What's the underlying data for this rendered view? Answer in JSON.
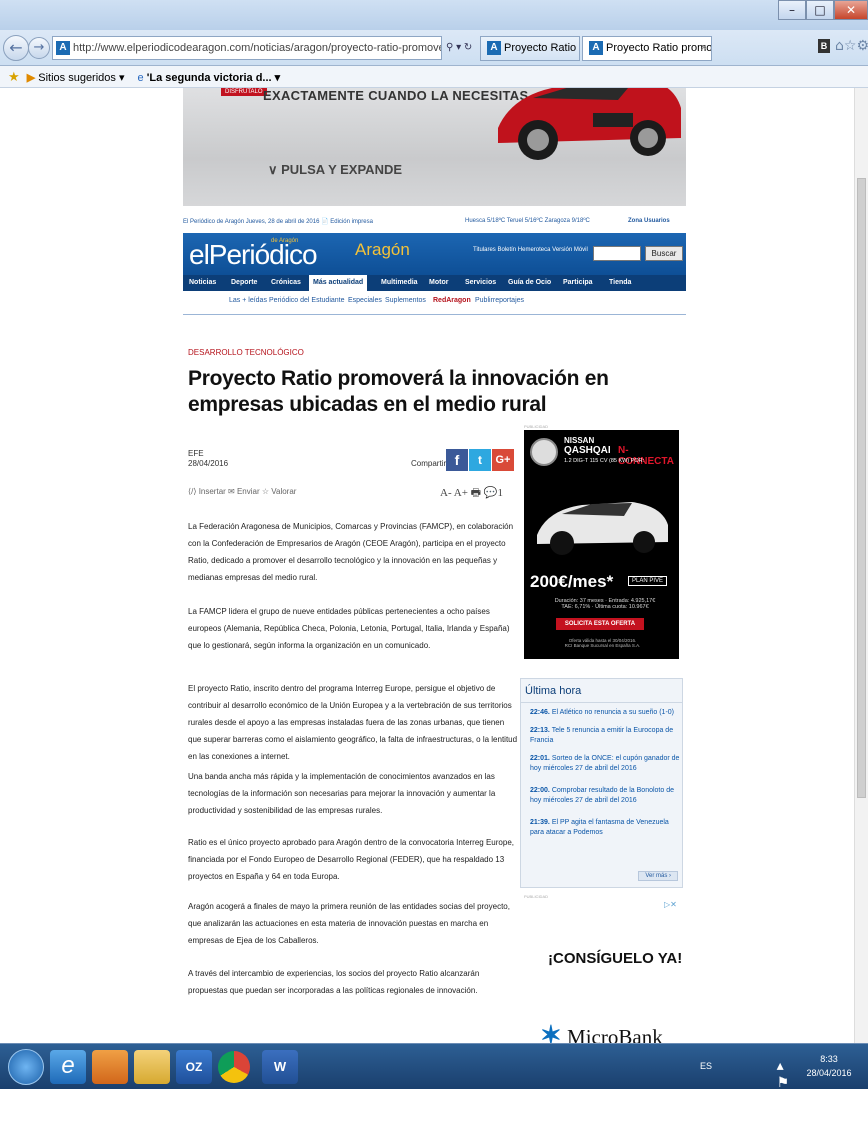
{
  "browser": {
    "address": "http://www.elperiodicodearagon.com/noticias/aragon/proyecto-ratio-promovera-innovaci",
    "address_domain": "elperiodicodearagon.com",
    "tabs": [
      {
        "label": "Proyecto Ratio promoverá la in..."
      },
      {
        "label": "Proyecto Ratio promoverá l..."
      }
    ],
    "tab_close": "×",
    "favorites": {
      "suggested": "Sitios sugeridos ▾",
      "link": "'La segunda victoria d... ▾"
    }
  },
  "ad_top": {
    "tag": "DISFRUTALO",
    "headline": "EXACTAMENTE CUANDO LA NECESITAS.",
    "cta": "∨ PULSA Y EXPANDE"
  },
  "site": {
    "meta": "El Periódico de Aragón  Jueves, 28 de abril de 2016  📄 Edición impresa",
    "weather": "Huesca 5/18ºC  Teruel 5/16ºC  Zaragoza 9/18ºC",
    "zona_usuarios": "Zona Usuarios",
    "logo": "elPeriódico",
    "logo_sub": "de Aragón",
    "region": "Aragón",
    "header_links": "Titulares  Boletín  Hemeroteca  Versión Móvil",
    "search_button": "Buscar",
    "nav": [
      "Noticias",
      "Deporte",
      "Crónicas",
      "Más actualidad",
      "Multimedia",
      "Motor",
      "Servicios",
      "Guía de Ocio",
      "Participa",
      "Tienda"
    ],
    "subnav": [
      "Las + leídas",
      "Periódico del Estudiante",
      "Especiales",
      "Suplementos",
      "RedAragon",
      "Publirreportajes"
    ]
  },
  "article": {
    "category": "DESARROLLO TECNOLÓGICO",
    "title": "Proyecto Ratio promoverá la innovación en empresas ubicadas en el medio rural",
    "author": "EFE",
    "date": "28/04/2016",
    "share_label": "Compartir:",
    "tools": "⟨/⟩ Insertar   ✉ Enviar   ☆ Valorar",
    "font_tools": "A-  A+  🖶  💬1",
    "paragraphs": [
      "La Federación Aragonesa de Municipios, Comarcas y Provincias (FAMCP), en colaboración con la Confederación de Empresarios de Aragón (CEOE Aragón), participa en el proyecto Ratio, dedicado a promover el desarrollo tecnológico y la innovación en las pequeñas y medianas empresas del medio rural.",
      "La FAMCP lidera el grupo de nueve entidades públicas pertenecientes a ocho países europeos (Alemania, República Checa, Polonia, Letonia, Portugal, Italia, Irlanda y España) que lo gestionará, según informa la organización en un comunicado.",
      "El proyecto Ratio, inscrito dentro del programa Interreg Europe, persigue el objetivo de contribuir al desarrollo económico de la Unión Europea y a la vertebración de sus territorios rurales desde el apoyo a las empresas instaladas fuera de las zonas urbanas, que tienen que superar barreras como el aislamiento geográfico, la falta de infraestructuras, o la lentitud en las conexiones a internet.",
      "Una banda ancha más rápida y la implementación de conocimientos avanzados en las tecnologías de la información son necesarias para mejorar la innovación y aumentar la productividad y sostenibilidad de las empresas rurales.",
      "Ratio es el único proyecto aprobado para Aragón dentro de la convocatoria Interreg Europe, financiada por el Fondo Europeo de Desarrollo Regional (FEDER), que ha respaldado 13 proyectos en España y 64 en toda Europa.",
      "Aragón acogerá a finales de mayo la primera reunión de las entidades socias del proyecto, que analizarán las actuaciones en esta materia de innovación puestas en marcha en empresas de Ejea de los Caballeros.",
      "A través del intercambio de experiencias, los socios del proyecto Ratio alcanzarán propuestas que puedan ser incorporadas a las políticas regionales de innovación."
    ]
  },
  "nissan_ad": {
    "label": "PUBLICIDAD",
    "brand": "NISSAN",
    "model": "QASHQAI",
    "edition": "N-CONNECTA",
    "engine": "1.2 DIG-T 115 CV (85 KW) POR:",
    "price": "200€/mes*",
    "plan": "PLAN PIVE",
    "terms": "Duración: 37 meses · Entrada: 4.925,17€\nTAE: 6,71% · Última cuota: 10.967€",
    "button": "SOLICITA ESTA OFERTA",
    "fineprint": "Oferta válida hasta el 30/04/2016.\nRCI Banque Sucursal en España S.A."
  },
  "ultima_hora": {
    "title": "Última hora",
    "items": [
      {
        "time": "22:46.",
        "text": "El Atlético no renuncia a su sueño (1-0)"
      },
      {
        "time": "22:13.",
        "text": "Tele 5 renuncia a emitir la Eurocopa de Francia"
      },
      {
        "time": "22:01.",
        "text": "Sorteo de la ONCE: el cupón ganador de hoy miércoles 27 de abril del 2016"
      },
      {
        "time": "22:00.",
        "text": "Comprobar resultado de la Bonoloto de hoy miércoles 27 de abril del 2016"
      },
      {
        "time": "21:39.",
        "text": "El PP agita el fantasma de Venezuela para atacar a Podemos"
      }
    ],
    "more": "Ver más ›"
  },
  "microbank_ad": {
    "label": "PUBLICIDAD",
    "slogan": "¡CONSÍGUELO YA!",
    "brand": "MicroBank"
  },
  "taskbar": {
    "lang": "ES",
    "time": "8:33",
    "date": "28/04/2016"
  },
  "colors": {
    "brand_blue": "#1c66b2",
    "nav_blue": "#0c3e78",
    "accent_red": "#b5121b",
    "facebook": "#3b5998",
    "twitter": "#2ea8e0",
    "gplus": "#d94a38"
  }
}
